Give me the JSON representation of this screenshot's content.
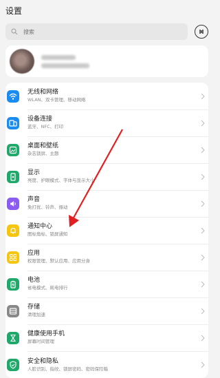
{
  "header": {
    "title": "设置"
  },
  "search": {
    "placeholder": "搜索"
  },
  "items": [
    {
      "label": "无线和网络",
      "sub": "WLAN、双卡管理、移动网络",
      "color": "#1a8cf0",
      "icon": "wifi-icon"
    },
    {
      "label": "设备连接",
      "sub": "蓝牙、NFC、打印",
      "color": "#1a8cf0",
      "icon": "device-connect-icon"
    },
    {
      "label": "桌面和壁纸",
      "sub": "杂志锁屏、主题",
      "color": "#20a86a",
      "icon": "wallpaper-icon"
    },
    {
      "label": "显示",
      "sub": "亮度、护眼模式、字体与显示大小",
      "color": "#20a86a",
      "icon": "display-icon"
    },
    {
      "label": "声音",
      "sub": "免打扰、铃声、振动",
      "color": "#8b5cf0",
      "icon": "sound-icon"
    },
    {
      "label": "通知中心",
      "sub": "图标角标、锁屏通知",
      "color": "#f5c50f",
      "icon": "bell-icon"
    },
    {
      "label": "应用",
      "sub": "权限管理、默认应用、应用分身",
      "color": "#f5c50f",
      "icon": "apps-icon"
    },
    {
      "label": "电池",
      "sub": "省电模式、耗电排行",
      "color": "#20a86a",
      "icon": "battery-icon"
    },
    {
      "label": "存储",
      "sub": "清理加速",
      "color": "#888888",
      "icon": "storage-icon"
    },
    {
      "label": "健康使用手机",
      "sub": "屏幕时间管理",
      "color": "#20a86a",
      "icon": "hourglass-icon"
    },
    {
      "label": "安全和隐私",
      "sub": "人脸识别、指纹、锁屏密码、密码保险箱",
      "color": "#20a86a",
      "icon": "shield-icon"
    }
  ],
  "annotation": {
    "arrow_color": "#e02020"
  }
}
